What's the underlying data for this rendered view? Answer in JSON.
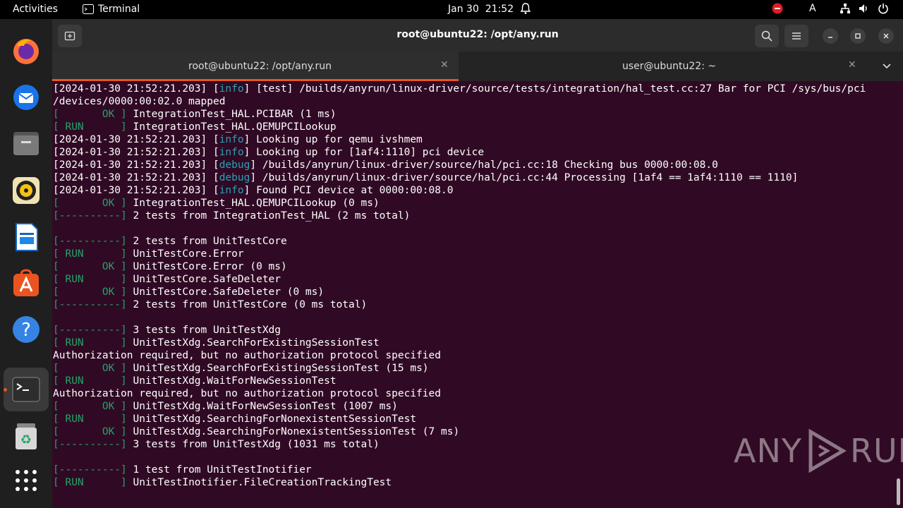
{
  "topbar": {
    "activities": "Activities",
    "app_name": "Terminal",
    "date": "Jan 30",
    "time": "21:52",
    "lang": "A"
  },
  "window": {
    "title": "root@ubuntu22: /opt/any.run",
    "tabs": [
      {
        "label": "root@ubuntu22: /opt/any.run",
        "active": true
      },
      {
        "label": "user@ubuntu22: ~",
        "active": false
      }
    ]
  },
  "dock": {
    "items": [
      "firefox-icon",
      "thunderbird-icon",
      "files-icon",
      "rhythmbox-icon",
      "writer-icon",
      "app-center-icon",
      "help-icon",
      "terminal-icon",
      "trash-icon",
      "show-apps-icon"
    ]
  },
  "terminal": {
    "lines": [
      [
        {
          "t": "[2024-01-30 21:52:21.203] ["
        },
        {
          "t": "info",
          "c": "c"
        },
        {
          "t": "] [test] /builds/anyrun/linux-driver/source/tests/integration/hal_test.cc:27 Bar for PCI /sys/bus/pci"
        }
      ],
      [
        {
          "t": "/devices/0000:00:02.0 mapped"
        }
      ],
      [
        {
          "t": "[       OK ]",
          "c": "g"
        },
        {
          "t": " IntegrationTest_HAL.PCIBAR (1 ms)"
        }
      ],
      [
        {
          "t": "[ RUN      ]",
          "c": "g"
        },
        {
          "t": " IntegrationTest_HAL.QEMUPCILookup"
        }
      ],
      [
        {
          "t": "[2024-01-30 21:52:21.203] ["
        },
        {
          "t": "info",
          "c": "c"
        },
        {
          "t": "] Looking up for qemu ivshmem"
        }
      ],
      [
        {
          "t": "[2024-01-30 21:52:21.203] ["
        },
        {
          "t": "info",
          "c": "c"
        },
        {
          "t": "] Looking up for [1af4:1110] pci device"
        }
      ],
      [
        {
          "t": "[2024-01-30 21:52:21.203] ["
        },
        {
          "t": "debug",
          "c": "c"
        },
        {
          "t": "] /builds/anyrun/linux-driver/source/hal/pci.cc:18 Checking bus 0000:00:08.0"
        }
      ],
      [
        {
          "t": "[2024-01-30 21:52:21.203] ["
        },
        {
          "t": "debug",
          "c": "c"
        },
        {
          "t": "] /builds/anyrun/linux-driver/source/hal/pci.cc:44 Processing [1af4 == 1af4:1110 == 1110]"
        }
      ],
      [
        {
          "t": "[2024-01-30 21:52:21.203] ["
        },
        {
          "t": "info",
          "c": "c"
        },
        {
          "t": "] Found PCI device at 0000:00:08.0"
        }
      ],
      [
        {
          "t": "[       OK ]",
          "c": "g"
        },
        {
          "t": " IntegrationTest_HAL.QEMUPCILookup (0 ms)"
        }
      ],
      [
        {
          "t": "[----------]",
          "c": "g"
        },
        {
          "t": " 2 tests from IntegrationTest_HAL (2 ms total)"
        }
      ],
      [
        {
          "t": ""
        }
      ],
      [
        {
          "t": "[----------]",
          "c": "g"
        },
        {
          "t": " 2 tests from UnitTestCore"
        }
      ],
      [
        {
          "t": "[ RUN      ]",
          "c": "g"
        },
        {
          "t": " UnitTestCore.Error"
        }
      ],
      [
        {
          "t": "[       OK ]",
          "c": "g"
        },
        {
          "t": " UnitTestCore.Error (0 ms)"
        }
      ],
      [
        {
          "t": "[ RUN      ]",
          "c": "g"
        },
        {
          "t": " UnitTestCore.SafeDeleter"
        }
      ],
      [
        {
          "t": "[       OK ]",
          "c": "g"
        },
        {
          "t": " UnitTestCore.SafeDeleter (0 ms)"
        }
      ],
      [
        {
          "t": "[----------]",
          "c": "g"
        },
        {
          "t": " 2 tests from UnitTestCore (0 ms total)"
        }
      ],
      [
        {
          "t": ""
        }
      ],
      [
        {
          "t": "[----------]",
          "c": "g"
        },
        {
          "t": " 3 tests from UnitTestXdg"
        }
      ],
      [
        {
          "t": "[ RUN      ]",
          "c": "g"
        },
        {
          "t": " UnitTestXdg.SearchForExistingSessionTest"
        }
      ],
      [
        {
          "t": "Authorization required, but no authorization protocol specified"
        }
      ],
      [
        {
          "t": "[       OK ]",
          "c": "g"
        },
        {
          "t": " UnitTestXdg.SearchForExistingSessionTest (15 ms)"
        }
      ],
      [
        {
          "t": "[ RUN      ]",
          "c": "g"
        },
        {
          "t": " UnitTestXdg.WaitForNewSessionTest"
        }
      ],
      [
        {
          "t": "Authorization required, but no authorization protocol specified"
        }
      ],
      [
        {
          "t": "[       OK ]",
          "c": "g"
        },
        {
          "t": " UnitTestXdg.WaitForNewSessionTest (1007 ms)"
        }
      ],
      [
        {
          "t": "[ RUN      ]",
          "c": "g"
        },
        {
          "t": " UnitTestXdg.SearchingForNonexistentSessionTest"
        }
      ],
      [
        {
          "t": "[       OK ]",
          "c": "g"
        },
        {
          "t": " UnitTestXdg.SearchingForNonexistentSessionTest (7 ms)"
        }
      ],
      [
        {
          "t": "[----------]",
          "c": "g"
        },
        {
          "t": " 3 tests from UnitTestXdg (1031 ms total)"
        }
      ],
      [
        {
          "t": ""
        }
      ],
      [
        {
          "t": "[----------]",
          "c": "g"
        },
        {
          "t": " 1 test from UnitTestInotifier"
        }
      ],
      [
        {
          "t": "[ RUN      ]",
          "c": "g"
        },
        {
          "t": " UnitTestInotifier.FileCreationTrackingTest"
        }
      ]
    ]
  },
  "watermark": {
    "left": "ANY",
    "right": "RUN"
  },
  "colors": {
    "terminal_bg": "#300a24",
    "green": "#26a269",
    "cyan": "#2aa1b3",
    "accent": "#e95420"
  }
}
